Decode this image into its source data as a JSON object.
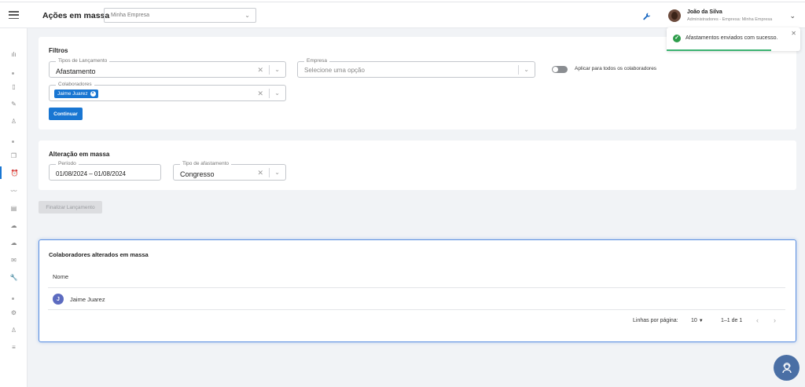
{
  "header": {
    "title": "Ações em massa",
    "company_select": "Minha Empresa",
    "user": {
      "name": "João da Silva",
      "role": "Administradores - Empresa: Minha Empresa"
    }
  },
  "sidebar": {
    "icons": [
      "chart-icon",
      "dot",
      "document-icon",
      "edit-icon",
      "person-icon",
      "dot",
      "copy-icon",
      "alarm-clock-icon",
      "trend-icon",
      "chat-icon",
      "cloud-icon",
      "cloud-upload-icon",
      "mail-icon",
      "wrench-icon",
      "dot",
      "gear-icon",
      "user-icon",
      "list-icon"
    ],
    "active_index": 7
  },
  "filters": {
    "title": "Filtros",
    "tipos_label": "Tipos de Lançamento",
    "tipos_value": "Afastamento",
    "empresa_label": "Empresa",
    "empresa_placeholder": "Selecione uma opção",
    "colaboradores_label": "Colaboradores",
    "colaborador_chip": "Jaime Juarez",
    "toggle_label": "Aplicar para todos os colaboradores",
    "toggle_on": false,
    "continue_button": "Continuar"
  },
  "alteracao": {
    "title": "Alteração em massa",
    "periodo_label": "Período",
    "periodo_value": "01/08/2024 – 01/08/2024",
    "tipo_label": "Tipo de afastamento",
    "tipo_value": "Congresso"
  },
  "finalizar_button": "Finalizar Lançamento",
  "results": {
    "title": "Colaboradores alterados em massa",
    "column_nome": "Nome",
    "rows": [
      {
        "initial": "J",
        "name": "Jaime Juarez"
      }
    ],
    "pager": {
      "label": "Linhas por página:",
      "size": "10",
      "range": "1–1 de 1"
    }
  },
  "toast": {
    "message": "Afastamentos enviados com sucesso.",
    "progress": 0.78,
    "color": "#2e9d4b"
  },
  "colors": {
    "primary": "#1976d2",
    "success": "#2e9d4b"
  }
}
